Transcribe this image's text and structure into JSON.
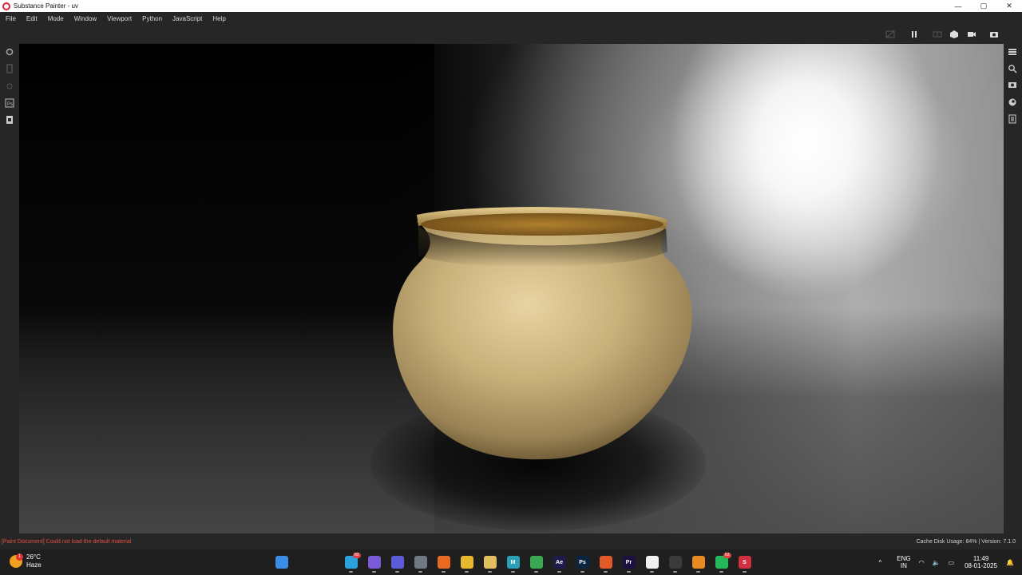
{
  "window": {
    "title": "Substance Painter - uv",
    "controls": [
      "—",
      "▢",
      "✕"
    ]
  },
  "menu": [
    "File",
    "Edit",
    "Mode",
    "Window",
    "Viewport",
    "Python",
    "JavaScript",
    "Help"
  ],
  "toolbar_icons": [
    "hide-overlay-icon",
    "pause-icon",
    "split-view-icon",
    "cube-view-icon",
    "camera-icon",
    "screenshot-icon"
  ],
  "left_tools": [
    "settings-icon",
    "shelf-icon",
    "lock-icon",
    "photoshop-icon",
    "document-icon"
  ],
  "right_tools": [
    "layers-panel-icon",
    "zoom-icon",
    "display-settings-icon",
    "environment-icon",
    "log-icon"
  ],
  "status": {
    "error": "[Paint Document] Could not load the default material",
    "cache": "Cache Disk Usage:    84% | Version: 7.1.0"
  },
  "taskbar": {
    "weather_temp": "26°C",
    "weather_desc": "Haze",
    "weather_badge": "1",
    "apps": [
      {
        "name": "windows-start-icon",
        "label": "",
        "color": "#3b8ee6"
      },
      {
        "name": "search-icon",
        "label": "",
        "color": "#1f1f1f"
      },
      {
        "name": "task-view-icon",
        "label": "",
        "color": "#1f1f1f"
      },
      {
        "name": "telegram-icon",
        "label": "",
        "color": "#2aa3dc",
        "count": "83"
      },
      {
        "name": "copilot-icon",
        "label": "",
        "color": "#7a5ad8"
      },
      {
        "name": "teams-icon",
        "label": "",
        "color": "#5c5cd6"
      },
      {
        "name": "settings-icon",
        "label": "",
        "color": "#6f7a85"
      },
      {
        "name": "firefox-icon",
        "label": "",
        "color": "#e86a20"
      },
      {
        "name": "file-explorer-icon",
        "label": "",
        "color": "#e6b830"
      },
      {
        "name": "maps-icon",
        "label": "",
        "color": "#e2c060"
      },
      {
        "name": "maya-icon",
        "label": "M",
        "color": "#2b9fb5"
      },
      {
        "name": "chrome-icon",
        "label": "",
        "color": "#38a853"
      },
      {
        "name": "after-effects-icon",
        "label": "Ae",
        "color": "#1e1b4a"
      },
      {
        "name": "photoshop-icon",
        "label": "Ps",
        "color": "#0a2540"
      },
      {
        "name": "brave-icon",
        "label": "",
        "color": "#e25a2a"
      },
      {
        "name": "premiere-icon",
        "label": "Pr",
        "color": "#1c1040"
      },
      {
        "name": "nero-icon",
        "label": "",
        "color": "#f0f0f0"
      },
      {
        "name": "unity-icon",
        "label": "",
        "color": "#3a3a3a"
      },
      {
        "name": "blender-icon",
        "label": "",
        "color": "#e88a20"
      },
      {
        "name": "whatsapp-icon",
        "label": "",
        "color": "#25b85a",
        "count": "53"
      },
      {
        "name": "substance-painter-icon",
        "label": "S",
        "color": "#d23040"
      }
    ],
    "lang_top": "ENG",
    "lang_bottom": "IN",
    "time": "11:49",
    "date": "08-01-2025"
  }
}
